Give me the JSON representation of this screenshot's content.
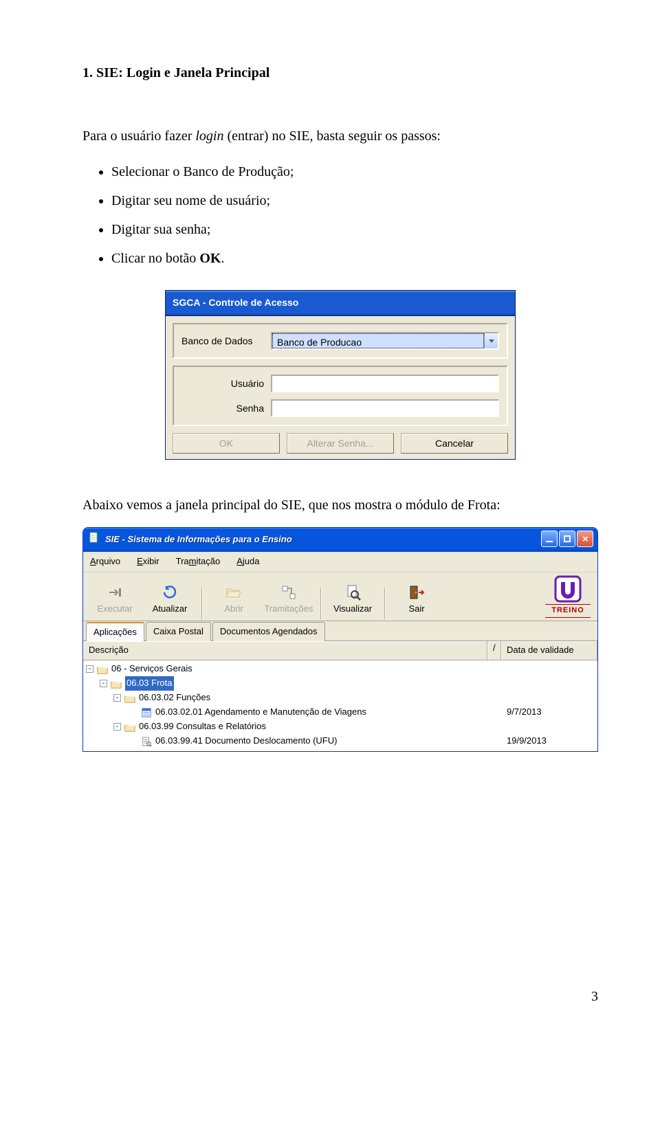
{
  "doc": {
    "heading": "1. SIE: Login e Janela Principal",
    "intro_pre": "Para o usuário fazer ",
    "intro_em": "login",
    "intro_post": " (entrar) no SIE, basta seguir os passos:",
    "steps": [
      "Selecionar o Banco de Produção;",
      "Digitar seu nome de usuário;",
      "Digitar sua senha;"
    ],
    "step_last_pre": "Clicar no botão ",
    "step_last_bold": "OK",
    "step_last_post": ".",
    "mid": "Abaixo vemos a janela principal do SIE, que nos mostra o módulo de Frota:",
    "page_number": "3"
  },
  "login": {
    "title": "SGCA - Controle de Acesso",
    "db_label": "Banco de Dados",
    "db_value": "Banco de Producao",
    "user_label": "Usuário",
    "pass_label": "Senha",
    "btn_ok": "OK",
    "btn_alterar": "Alterar Senha...",
    "btn_cancelar": "Cancelar"
  },
  "sie": {
    "title": "SIE - Sistema de Informações para o Ensino",
    "logo_text": "TREINO",
    "menus": {
      "arquivo": "Arquivo",
      "exibir": "Exibir",
      "tramitacao_pre": "Tra",
      "tramitacao_und": "m",
      "tramitacao_post": "itação",
      "ajuda": "Ajuda"
    },
    "toolbar": {
      "executar": "Executar",
      "atualizar": "Atualizar",
      "abrir": "Abrir",
      "tramitacoes": "Tramitações",
      "visualizar": "Visualizar",
      "sair": "Sair"
    },
    "tabs": {
      "aplicacoes": "Aplicações",
      "caixa": "Caixa Postal",
      "agendados": "Documentos Agendados"
    },
    "columns": {
      "descricao": "Descrição",
      "validade": "Data de validade"
    },
    "tree": [
      {
        "level": 1,
        "toggle": "-",
        "icon": "folder",
        "label": "06 - Serviços Gerais",
        "date": "",
        "selected": false
      },
      {
        "level": 2,
        "toggle": "-",
        "icon": "folder",
        "label": "06.03 Frota",
        "date": "",
        "selected": true
      },
      {
        "level": 3,
        "toggle": "-",
        "icon": "folder",
        "label": "06.03.02 Funções",
        "date": "",
        "selected": false
      },
      {
        "level": 4,
        "toggle": "",
        "icon": "form",
        "label": "06.03.02.01 Agendamento e Manutenção de Viagens",
        "date": "9/7/2013",
        "selected": false
      },
      {
        "level": 3,
        "toggle": "-",
        "icon": "folder",
        "label": "06.03.99 Consultas e Relatórios",
        "date": "",
        "selected": false
      },
      {
        "level": 4,
        "toggle": "",
        "icon": "report",
        "label": "06.03.99.41 Documento Deslocamento (UFU)",
        "date": "19/9/2013",
        "selected": false
      }
    ]
  }
}
